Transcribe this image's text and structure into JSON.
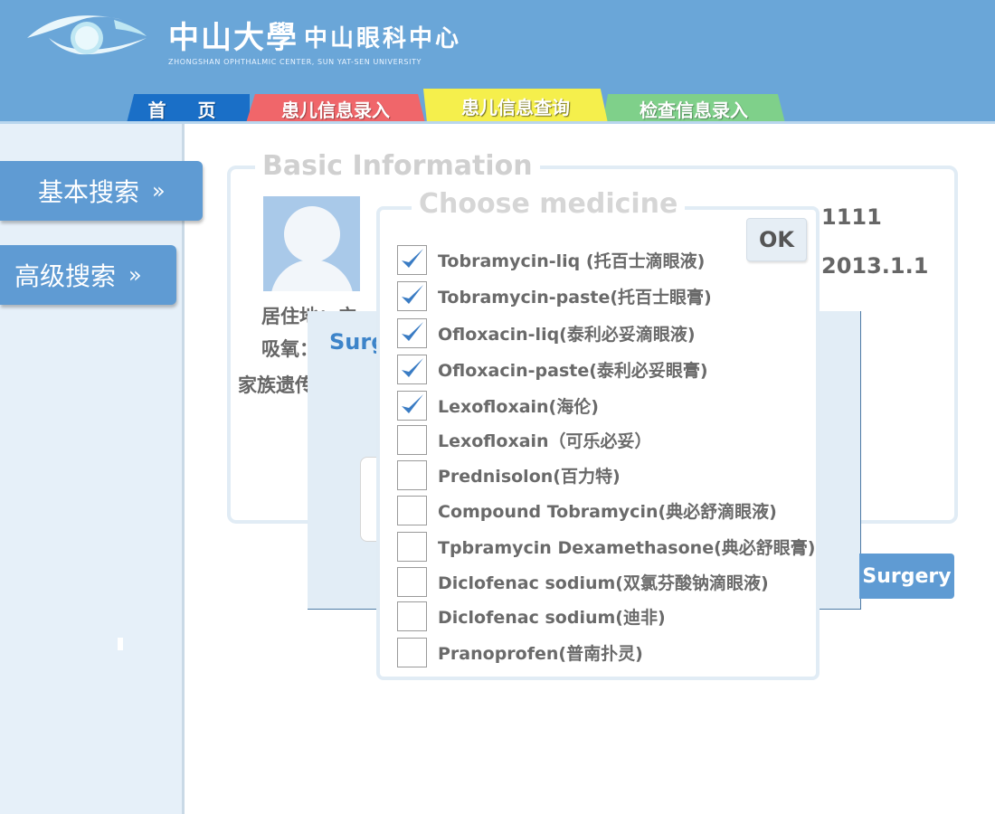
{
  "header": {
    "brand_cn": "中山大學",
    "brand_cn_center": "中山眼科中心",
    "brand_en": "ZHONGSHAN OPHTHALMIC CENTER, SUN YAT-SEN UNIVERSITY",
    "tabs": [
      {
        "label": "首 页",
        "color": "#1a6fc7"
      },
      {
        "label": "患儿信息录入",
        "color": "#f0666a"
      },
      {
        "label": "患儿信息查询",
        "color": "#f5ef4c"
      },
      {
        "label": "检查信息录入",
        "color": "#7fd08a"
      }
    ]
  },
  "sidebar": {
    "items": [
      {
        "label": "基本搜索"
      },
      {
        "label": "高级搜索"
      }
    ],
    "chevron": "»"
  },
  "basic_info": {
    "legend": "Basic Information",
    "row1": "居住地：广",
    "row2": "吸氧：",
    "row3": "家族遗传",
    "value1": "1111",
    "value2": "2013.1.1"
  },
  "surgery_dialog": {
    "title": "Surg",
    "button_label": "Surgery"
  },
  "medicine_dialog": {
    "legend": "Choose medicine",
    "ok_label": "OK",
    "items": [
      {
        "label": "Tobramycin-liq (托百士滴眼液)",
        "checked": true
      },
      {
        "label": "Tobramycin-paste(托百士眼膏)",
        "checked": true
      },
      {
        "label": "Ofloxacin-liq(泰利必妥滴眼液)",
        "checked": true
      },
      {
        "label": "Ofloxacin-paste(泰利必妥眼膏)",
        "checked": true
      },
      {
        "label": "Lexofloxain(海伦)",
        "checked": true
      },
      {
        "label": "Lexofloxain（可乐必妥）",
        "checked": false
      },
      {
        "label": "Prednisolon(百力特)",
        "checked": false
      },
      {
        "label": "Compound  Tobramycin(典必舒滴眼液)",
        "checked": false
      },
      {
        "label": "Tpbramycin  Dexamethasone(典必舒眼膏)",
        "checked": false
      },
      {
        "label": "Diclofenac  sodium(双氯芬酸钠滴眼液)",
        "checked": false
      },
      {
        "label": "Diclofenac  sodium(迪非)",
        "checked": false
      },
      {
        "label": "Pranoprofen(普南扑灵)",
        "checked": false
      }
    ]
  },
  "colors": {
    "header_bg": "#6aa6d8",
    "accent_blue": "#5f9bd3",
    "check_blue": "#3a7cc4"
  }
}
